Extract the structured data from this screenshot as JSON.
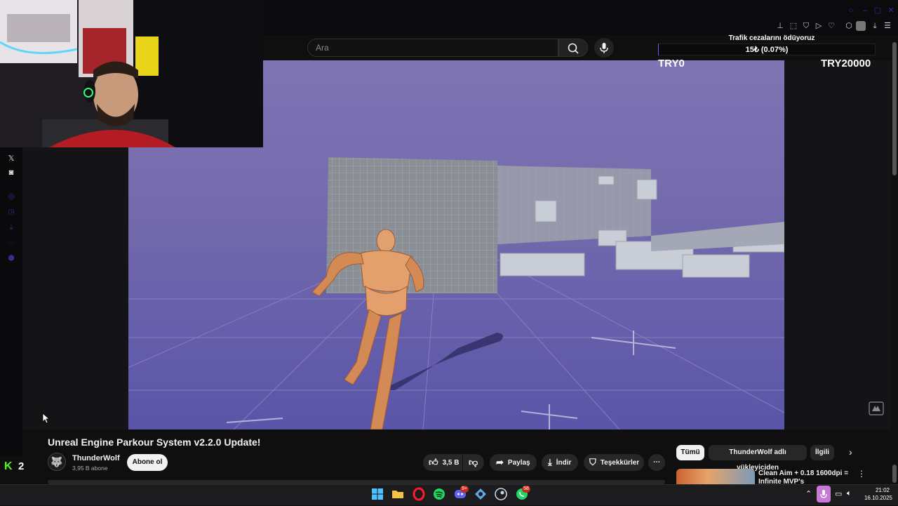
{
  "browser": {
    "toolbar_icons": [
      "pin-icon",
      "screenshot-icon",
      "shield-icon",
      "play-icon",
      "heart-icon",
      "extensions-icon",
      "avatar-icon",
      "download-icon",
      "menu-icon"
    ]
  },
  "search": {
    "placeholder": "Ara"
  },
  "overlay": {
    "goal_title": "Trafik cezalarını ödüyoruz",
    "goal_progress_text": "15₺ (0.07%)",
    "goal_fraction": 0.0007,
    "goal_min": "TRY0",
    "goal_max": "TRY20000",
    "accent": "#6b5cff"
  },
  "left_rail": {
    "icons": [
      "x-icon",
      "discord-icon",
      "circle-icon",
      "clock-icon",
      "download-icon",
      "chat-icon",
      "cube-icon"
    ]
  },
  "kick": {
    "logo": "K",
    "count": "2",
    "color": "#53fc18"
  },
  "video": {
    "title": "Unreal Engine Parkour System v2.2.0 Update!",
    "channel": "ThunderWolf",
    "subscribers": "3,95 B abone",
    "subscribe_label": "Abone ol",
    "likes": "3,5 B",
    "share_label": "Paylaş",
    "download_label": "İndir",
    "thanks_label": "Teşekkürler"
  },
  "chips": {
    "all": "Tümü",
    "uploader": "ThunderWolf adlı yükleyiciden",
    "related": "İlgili"
  },
  "recommended": {
    "title": "Clean Aim + 0.18 1600dpi = Infinite MVP's"
  },
  "taskbar": {
    "apps": [
      "windows-icon",
      "folder-icon",
      "opera-icon",
      "spotify-icon",
      "discord-icon",
      "app-icon",
      "steam-icon",
      "whatsapp-icon"
    ],
    "discord_badge": "9+",
    "whatsapp_badge": "58",
    "time": "21:02",
    "date": "16.10.2025"
  }
}
